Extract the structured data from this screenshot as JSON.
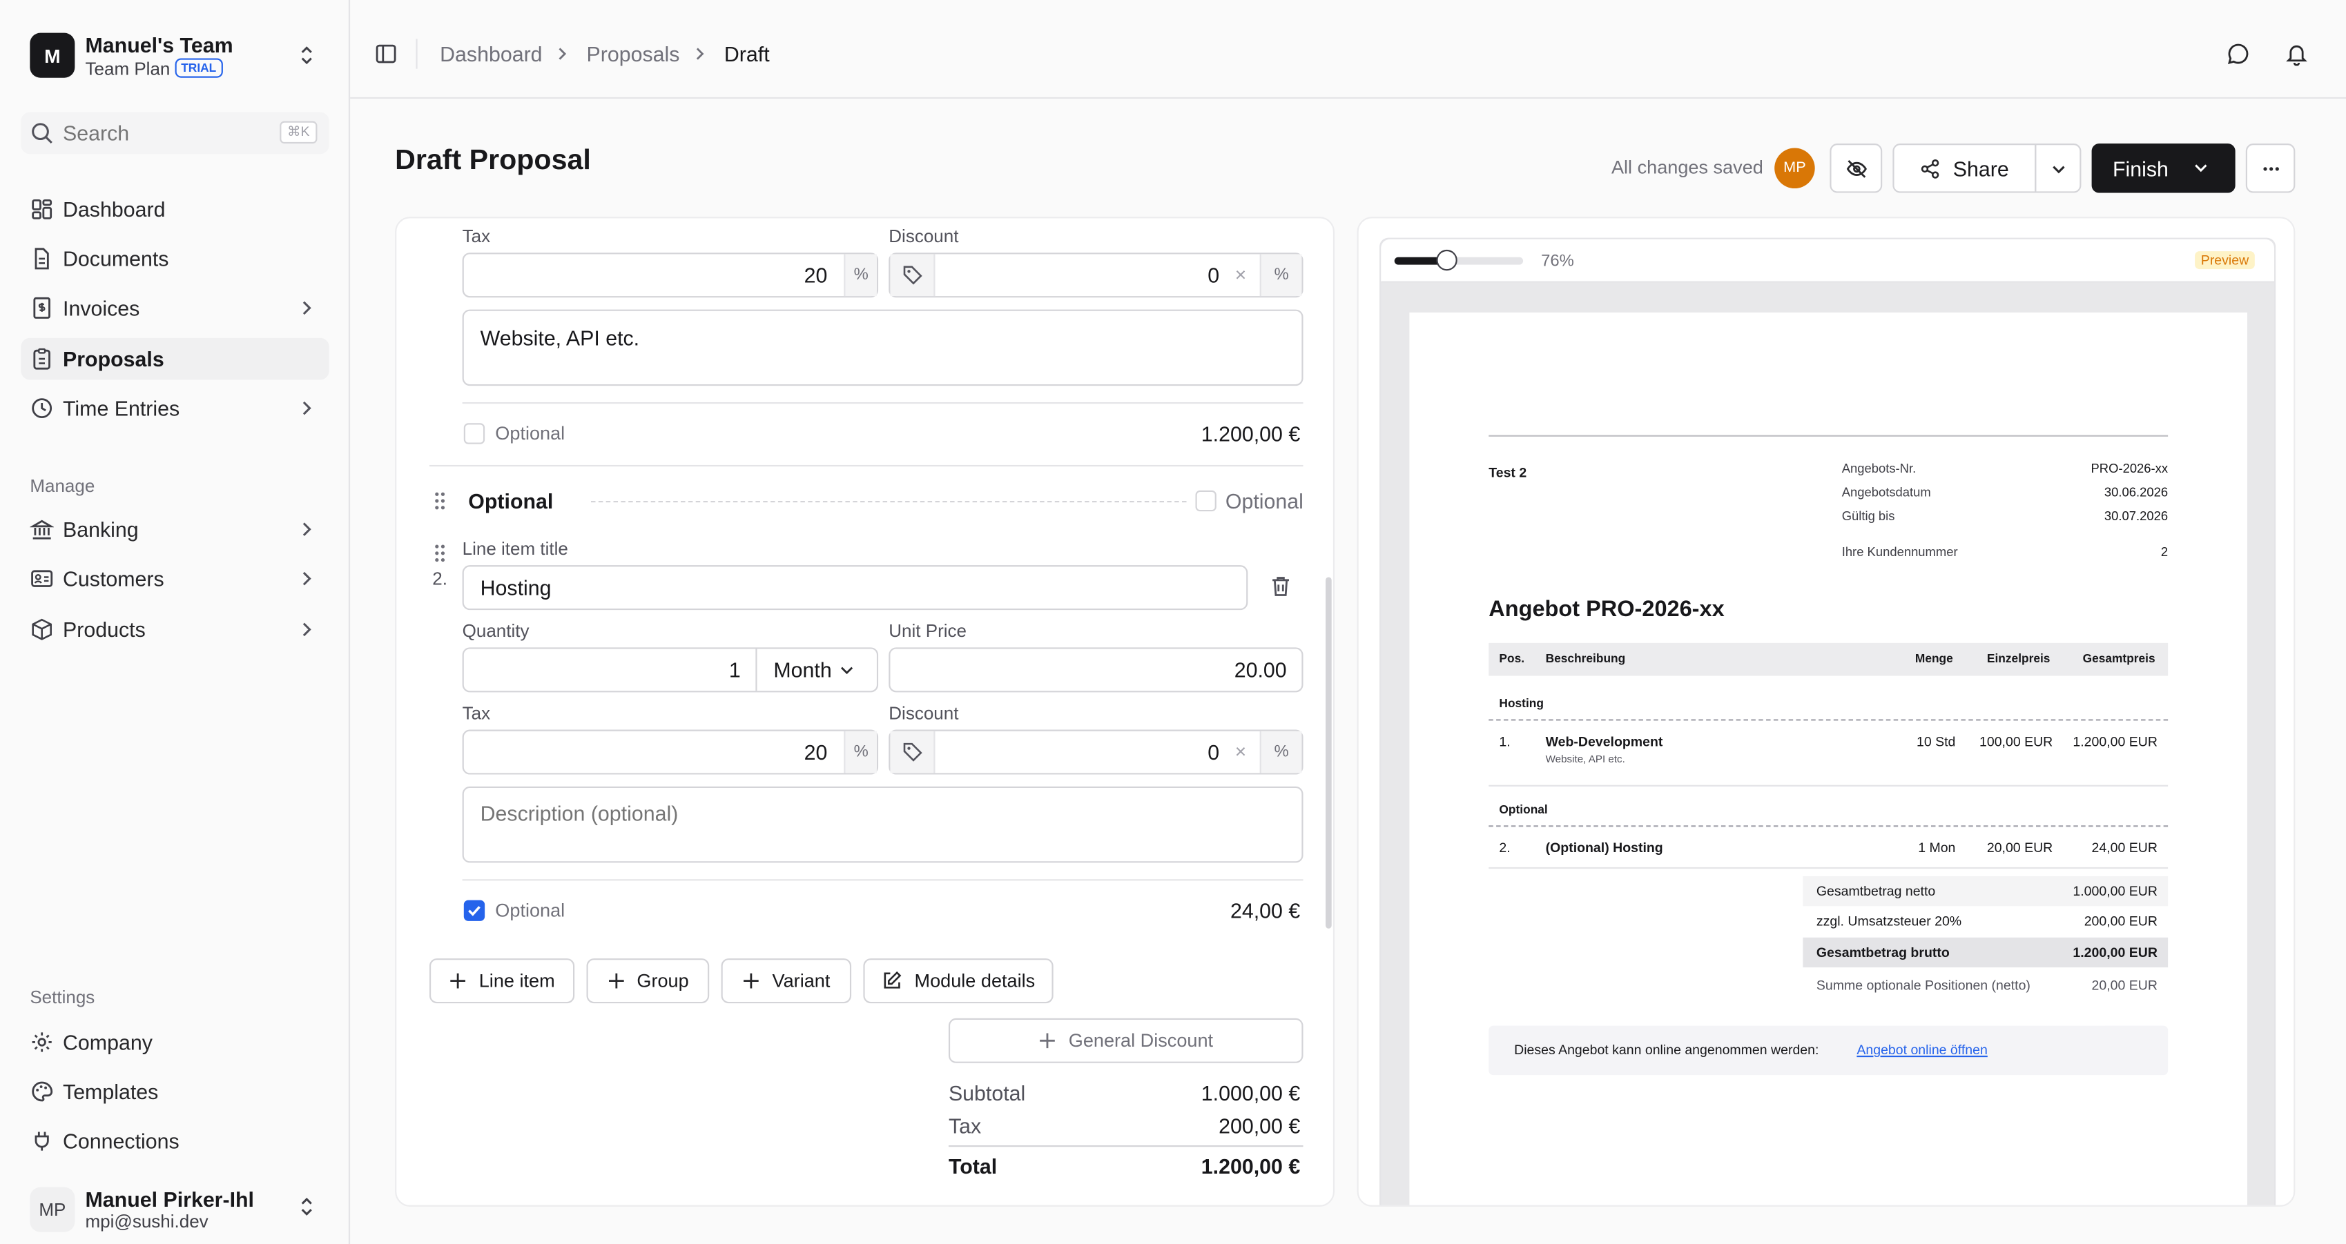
{
  "team": {
    "initial": "M",
    "name": "Manuel's Team",
    "plan": "Team Plan",
    "badge": "TRIAL"
  },
  "search": {
    "placeholder": "Search",
    "shortcut": "⌘K"
  },
  "nav": [
    {
      "label": "Dashboard",
      "icon": "dashboard-icon"
    },
    {
      "label": "Documents",
      "icon": "document-icon"
    },
    {
      "label": "Invoices",
      "icon": "invoice-icon"
    },
    {
      "label": "Proposals",
      "icon": "proposal-icon"
    },
    {
      "label": "Time Entries",
      "icon": "clock-icon"
    }
  ],
  "manage": {
    "label": "Manage",
    "items": [
      {
        "label": "Banking"
      },
      {
        "label": "Customers"
      },
      {
        "label": "Products"
      }
    ]
  },
  "settings": {
    "label": "Settings",
    "items": [
      {
        "label": "Company"
      },
      {
        "label": "Templates"
      },
      {
        "label": "Connections"
      }
    ]
  },
  "user": {
    "initials": "MP",
    "name": "Manuel Pirker-Ihl",
    "email": "mpi@sushi.dev"
  },
  "breadcrumb": [
    "Dashboard",
    "Proposals",
    "Draft"
  ],
  "page": {
    "title": "Draft Proposal",
    "save_status": "All changes saved",
    "avatar": "MP",
    "share": "Share",
    "finish": "Finish"
  },
  "item1": {
    "tax_label": "Tax",
    "tax": "20",
    "pct": "%",
    "discount_label": "Discount",
    "discount": "0",
    "x": "×",
    "description": "Website, API etc.",
    "optional": "Optional",
    "total": "1.200,00 €"
  },
  "group": {
    "title": "Optional",
    "optional": "Optional"
  },
  "item2": {
    "number": "2.",
    "title_label": "Line item title",
    "title": "Hosting",
    "quantity_label": "Quantity",
    "quantity": "1",
    "unit": "Month",
    "price_label": "Unit Price",
    "price": "20.00",
    "tax_label": "Tax",
    "tax": "20",
    "discount_label": "Discount",
    "discount": "0",
    "description_placeholder": "Description (optional)",
    "optional": "Optional",
    "total": "24,00 €"
  },
  "actions": {
    "line_item": "Line item",
    "group": "Group",
    "variant": "Variant",
    "module": "Module details",
    "general_discount": "General Discount"
  },
  "totals": {
    "subtotal_label": "Subtotal",
    "subtotal": "1.000,00 €",
    "tax_label": "Tax",
    "tax": "200,00 €",
    "total_label": "Total",
    "total": "1.200,00 €"
  },
  "preview": {
    "zoom": "76%",
    "zoom_fraction": 0.76,
    "badge": "Preview",
    "customer": "Test 2",
    "meta": [
      {
        "k": "Angebots-Nr.",
        "v": "PRO-2026-xx"
      },
      {
        "k": "Angebotsdatum",
        "v": "30.06.2026"
      },
      {
        "k": "Gültig bis",
        "v": "30.07.2026"
      },
      {
        "k": "Ihre Kundennummer",
        "v": "2"
      }
    ],
    "title": "Angebot PRO-2026-xx",
    "headers": {
      "pos": "Pos.",
      "desc": "Beschreibung",
      "qty": "Menge",
      "unit": "Einzelpreis",
      "total": "Gesamtpreis"
    },
    "groups": [
      {
        "name": "Hosting",
        "rows": [
          {
            "pos": "1.",
            "title": "Web-Development",
            "sub": "Website, API etc.",
            "qty": "10 Std",
            "unit": "100,00 EUR",
            "total": "1.200,00 EUR"
          }
        ]
      },
      {
        "name": "Optional",
        "rows": [
          {
            "pos": "2.",
            "title": "(Optional) Hosting",
            "sub": "",
            "qty": "1 Mon",
            "unit": "20,00 EUR",
            "total": "24,00 EUR"
          }
        ]
      }
    ],
    "summary": [
      {
        "k": "Gesamtbetrag netto",
        "v": "1.000,00 EUR"
      },
      {
        "k": "zzgl. Umsatzsteuer 20%",
        "v": "200,00 EUR"
      },
      {
        "k": "Gesamtbetrag brutto",
        "v": "1.200,00 EUR"
      },
      {
        "k": "Summe optionale Positionen (netto)",
        "v": "20,00 EUR"
      }
    ],
    "note": "Dieses Angebot kann online angenommen werden:",
    "note_link": "Angebot online öffnen"
  }
}
